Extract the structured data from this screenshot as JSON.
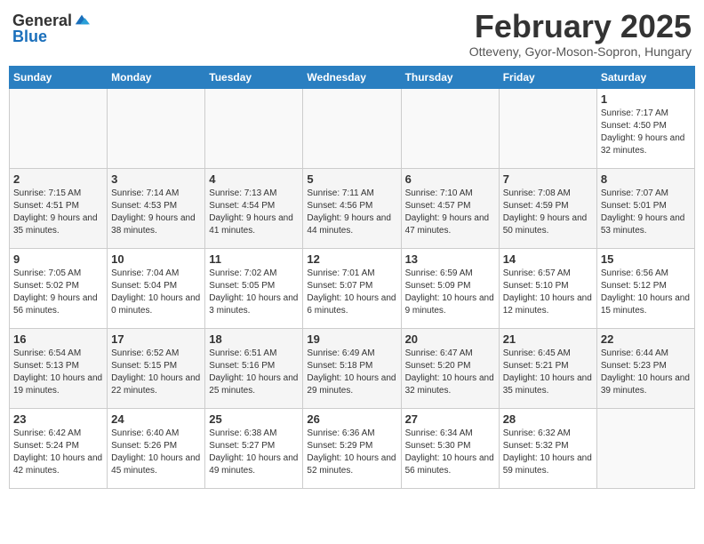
{
  "logo": {
    "general": "General",
    "blue": "Blue"
  },
  "header": {
    "month": "February 2025",
    "location": "Otteveny, Gyor-Moson-Sopron, Hungary"
  },
  "weekdays": [
    "Sunday",
    "Monday",
    "Tuesday",
    "Wednesday",
    "Thursday",
    "Friday",
    "Saturday"
  ],
  "weeks": [
    [
      {
        "day": "",
        "info": ""
      },
      {
        "day": "",
        "info": ""
      },
      {
        "day": "",
        "info": ""
      },
      {
        "day": "",
        "info": ""
      },
      {
        "day": "",
        "info": ""
      },
      {
        "day": "",
        "info": ""
      },
      {
        "day": "1",
        "info": "Sunrise: 7:17 AM\nSunset: 4:50 PM\nDaylight: 9 hours and 32 minutes."
      }
    ],
    [
      {
        "day": "2",
        "info": "Sunrise: 7:15 AM\nSunset: 4:51 PM\nDaylight: 9 hours and 35 minutes."
      },
      {
        "day": "3",
        "info": "Sunrise: 7:14 AM\nSunset: 4:53 PM\nDaylight: 9 hours and 38 minutes."
      },
      {
        "day": "4",
        "info": "Sunrise: 7:13 AM\nSunset: 4:54 PM\nDaylight: 9 hours and 41 minutes."
      },
      {
        "day": "5",
        "info": "Sunrise: 7:11 AM\nSunset: 4:56 PM\nDaylight: 9 hours and 44 minutes."
      },
      {
        "day": "6",
        "info": "Sunrise: 7:10 AM\nSunset: 4:57 PM\nDaylight: 9 hours and 47 minutes."
      },
      {
        "day": "7",
        "info": "Sunrise: 7:08 AM\nSunset: 4:59 PM\nDaylight: 9 hours and 50 minutes."
      },
      {
        "day": "8",
        "info": "Sunrise: 7:07 AM\nSunset: 5:01 PM\nDaylight: 9 hours and 53 minutes."
      }
    ],
    [
      {
        "day": "9",
        "info": "Sunrise: 7:05 AM\nSunset: 5:02 PM\nDaylight: 9 hours and 56 minutes."
      },
      {
        "day": "10",
        "info": "Sunrise: 7:04 AM\nSunset: 5:04 PM\nDaylight: 10 hours and 0 minutes."
      },
      {
        "day": "11",
        "info": "Sunrise: 7:02 AM\nSunset: 5:05 PM\nDaylight: 10 hours and 3 minutes."
      },
      {
        "day": "12",
        "info": "Sunrise: 7:01 AM\nSunset: 5:07 PM\nDaylight: 10 hours and 6 minutes."
      },
      {
        "day": "13",
        "info": "Sunrise: 6:59 AM\nSunset: 5:09 PM\nDaylight: 10 hours and 9 minutes."
      },
      {
        "day": "14",
        "info": "Sunrise: 6:57 AM\nSunset: 5:10 PM\nDaylight: 10 hours and 12 minutes."
      },
      {
        "day": "15",
        "info": "Sunrise: 6:56 AM\nSunset: 5:12 PM\nDaylight: 10 hours and 15 minutes."
      }
    ],
    [
      {
        "day": "16",
        "info": "Sunrise: 6:54 AM\nSunset: 5:13 PM\nDaylight: 10 hours and 19 minutes."
      },
      {
        "day": "17",
        "info": "Sunrise: 6:52 AM\nSunset: 5:15 PM\nDaylight: 10 hours and 22 minutes."
      },
      {
        "day": "18",
        "info": "Sunrise: 6:51 AM\nSunset: 5:16 PM\nDaylight: 10 hours and 25 minutes."
      },
      {
        "day": "19",
        "info": "Sunrise: 6:49 AM\nSunset: 5:18 PM\nDaylight: 10 hours and 29 minutes."
      },
      {
        "day": "20",
        "info": "Sunrise: 6:47 AM\nSunset: 5:20 PM\nDaylight: 10 hours and 32 minutes."
      },
      {
        "day": "21",
        "info": "Sunrise: 6:45 AM\nSunset: 5:21 PM\nDaylight: 10 hours and 35 minutes."
      },
      {
        "day": "22",
        "info": "Sunrise: 6:44 AM\nSunset: 5:23 PM\nDaylight: 10 hours and 39 minutes."
      }
    ],
    [
      {
        "day": "23",
        "info": "Sunrise: 6:42 AM\nSunset: 5:24 PM\nDaylight: 10 hours and 42 minutes."
      },
      {
        "day": "24",
        "info": "Sunrise: 6:40 AM\nSunset: 5:26 PM\nDaylight: 10 hours and 45 minutes."
      },
      {
        "day": "25",
        "info": "Sunrise: 6:38 AM\nSunset: 5:27 PM\nDaylight: 10 hours and 49 minutes."
      },
      {
        "day": "26",
        "info": "Sunrise: 6:36 AM\nSunset: 5:29 PM\nDaylight: 10 hours and 52 minutes."
      },
      {
        "day": "27",
        "info": "Sunrise: 6:34 AM\nSunset: 5:30 PM\nDaylight: 10 hours and 56 minutes."
      },
      {
        "day": "28",
        "info": "Sunrise: 6:32 AM\nSunset: 5:32 PM\nDaylight: 10 hours and 59 minutes."
      },
      {
        "day": "",
        "info": ""
      }
    ]
  ]
}
